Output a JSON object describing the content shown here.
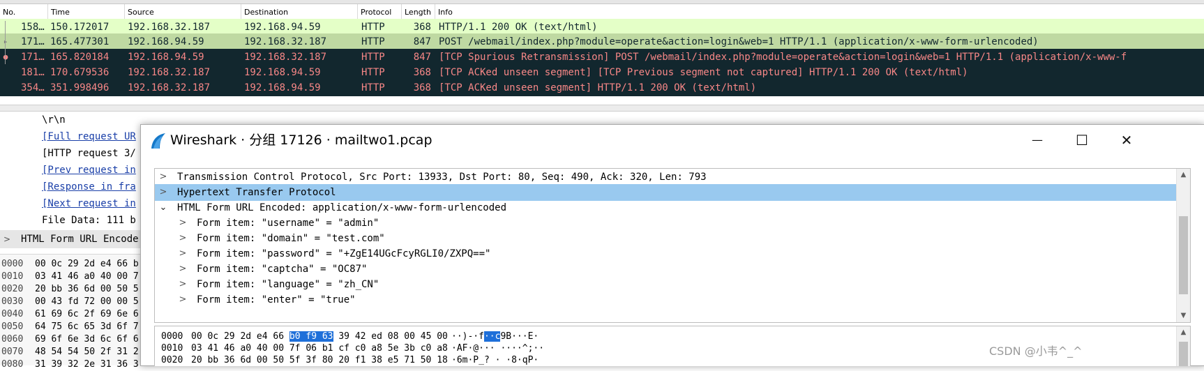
{
  "packet_list": {
    "columns": [
      "No.",
      "Time",
      "Source",
      "Destination",
      "Protocol",
      "Length",
      "Info"
    ],
    "rows": [
      {
        "no": "158…",
        "time": "150.172017",
        "source": "192.168.32.187",
        "destination": "192.168.94.59",
        "protocol": "HTTP",
        "length": "368",
        "info": "HTTP/1.1 200 OK  (text/html)"
      },
      {
        "no": "171…",
        "time": "165.477301",
        "source": "192.168.94.59",
        "destination": "192.168.32.187",
        "protocol": "HTTP",
        "length": "847",
        "info": "POST /webmail/index.php?module=operate&action=login&web=1 HTTP/1.1  (application/x-www-form-urlencoded)"
      },
      {
        "no": "171…",
        "time": "165.820184",
        "source": "192.168.94.59",
        "destination": "192.168.32.187",
        "protocol": "HTTP",
        "length": "847",
        "info": "[TCP Spurious Retransmission] POST /webmail/index.php?module=operate&action=login&web=1 HTTP/1.1  (application/x-www-f"
      },
      {
        "no": "181…",
        "time": "170.679536",
        "source": "192.168.32.187",
        "destination": "192.168.94.59",
        "protocol": "HTTP",
        "length": "368",
        "info": "[TCP ACKed unseen segment] [TCP Previous segment not captured] HTTP/1.1 200 OK  (text/html)"
      },
      {
        "no": "354…",
        "time": "351.998496",
        "source": "192.168.32.187",
        "destination": "192.168.94.59",
        "protocol": "HTTP",
        "length": "368",
        "info": "[TCP ACKed unseen segment] HTTP/1.1 200 OK  (text/html)"
      }
    ]
  },
  "background_details": {
    "lines": [
      "\\r\\n",
      "[Full request UR",
      "[HTTP request 3/",
      "[Prev request in",
      "[Response in fra",
      "[Next request in",
      "File Data: 111 b"
    ],
    "selected_item": "HTML Form URL Encode"
  },
  "background_hex": [
    {
      "offset": "0000",
      "bytes": "00 0c 29 2d e4 66 b"
    },
    {
      "offset": "0010",
      "bytes": "03 41 46 a0 40 00 7"
    },
    {
      "offset": "0020",
      "bytes": "20 bb 36 6d 00 50 5"
    },
    {
      "offset": "0030",
      "bytes": "00 43 fd 72 00 00 5"
    },
    {
      "offset": "0040",
      "bytes": "61 69 6c 2f 69 6e 6"
    },
    {
      "offset": "0050",
      "bytes": "64 75 6c 65 3d 6f 7"
    },
    {
      "offset": "0060",
      "bytes": "69 6f 6e 3d 6c 6f 6"
    },
    {
      "offset": "0070",
      "bytes": "48 54 54 50 2f 31 2"
    },
    {
      "offset": "0080",
      "bytes": "31 39 32 2e 31 36 3"
    }
  ],
  "popup": {
    "title": "Wireshark · 分组 17126 · mailtwo1.pcap",
    "minimize_glyph": "—",
    "maximize_glyph": "☐",
    "close_glyph": "✕",
    "tree": [
      {
        "text": "Transmission Control Protocol, Src Port: 13933, Dst Port: 80, Seq: 490, Ack: 320, Len: 793"
      },
      {
        "text": "Hypertext Transfer Protocol"
      },
      {
        "text": "HTML Form URL Encoded: application/x-www-form-urlencoded"
      },
      {
        "text": "Form item: \"username\" = \"admin\""
      },
      {
        "text": "Form item: \"domain\" = \"test.com\""
      },
      {
        "text": "Form item: \"password\" = \"+ZgE14UGcFcyRGLI0/ZXPQ==\""
      },
      {
        "text": "Form item: \"captcha\" = \"OC87\""
      },
      {
        "text": "Form item: \"language\" = \"zh_CN\""
      },
      {
        "text": "Form item: \"enter\" = \"true\""
      }
    ],
    "hex": [
      {
        "offset": "0000",
        "bytes_a": "00 0c 29 2d e4 66 ",
        "bytes_hl": "b0 f9  63",
        "bytes_b": " 39 42 ed 08 00 45 00",
        "ascii_a": "··)-·f",
        "ascii_hl": "··c",
        "ascii_b": "9B···E·"
      },
      {
        "offset": "0010",
        "bytes_a": "03 41 46 a0 40 00 7f 06  b1 cf c0 a8 5e 3b c0 a8",
        "ascii_a": "·AF·@··· ····^;··"
      },
      {
        "offset": "0020",
        "bytes_a": "20 bb 36 6d 00 50 5f 3f  80 20 f1 38 e5 71 50 18",
        "ascii_a": " ·6m·P_? · ·8·qP·"
      }
    ]
  },
  "watermark": "CSDN @小韦^_^"
}
